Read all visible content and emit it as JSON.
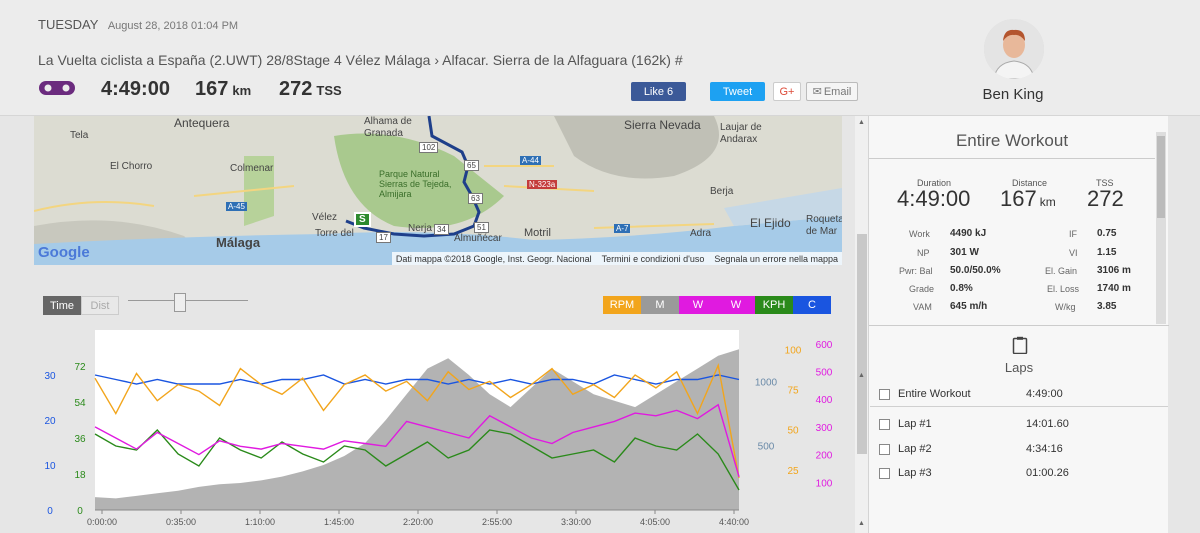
{
  "header": {
    "day": "TUESDAY",
    "date_sub": "August 28, 2018 01:04 PM",
    "title": "La Vuelta ciclista a España (2.UWT) 28/8Stage 4   Vélez Málaga › Alfacar. Sierra de la Alfaguara (162k) #",
    "duration": "4:49:00",
    "distance": "167",
    "distance_unit": "km",
    "tss": "272",
    "tss_unit": "TSS",
    "like_label": "Like 6",
    "tweet_label": "Tweet",
    "gplus_label": "G+",
    "email_label": "Email"
  },
  "user": {
    "name": "Ben King"
  },
  "map": {
    "labels": [
      "Antequera",
      "Alhama de Granada",
      "Tela",
      "Colmenar",
      "El Chorro",
      "Parque Natural Sierras de Tejeda, Almijara",
      "Vélez",
      "Torre del Mar",
      "Málaga",
      "Nerja",
      "Almuñécar",
      "Motril",
      "Sierra Nevada",
      "Laujar de Andarax",
      "Berja",
      "El Ejido",
      "Adra",
      "Roquetas de Mar"
    ],
    "roads": [
      "A-45",
      "A-44",
      "N-323a",
      "A-7"
    ],
    "route_marks": [
      "102",
      "65",
      "63",
      "51",
      "34",
      "17"
    ],
    "start_marker": "S",
    "google": "Google",
    "credits": [
      "Dati mappa ©2018 Google, Inst. Geogr. Nacional",
      "Termini e condizioni d'uso",
      "Segnala un errore nella mappa"
    ]
  },
  "chart_controls": {
    "time_label": "Time",
    "dist_label": "Dist",
    "legend": [
      {
        "label": "RPM",
        "color": "#f2a51c"
      },
      {
        "label": "M",
        "color": "#9a9a9a"
      },
      {
        "label": "W",
        "color": "#e01ae0"
      },
      {
        "label": "W",
        "color": "#e01ae0"
      },
      {
        "label": "KPH",
        "color": "#2a8a1a"
      },
      {
        "label": "C",
        "color": "#1a55e0"
      }
    ]
  },
  "chart_data": {
    "type": "line",
    "x": [
      "0:00:00",
      "0:35:00",
      "1:10:00",
      "1:45:00",
      "2:20:00",
      "2:55:00",
      "3:30:00",
      "4:05:00",
      "4:40:00"
    ],
    "axes": {
      "blue_left": [
        "0",
        "10",
        "20",
        "30"
      ],
      "green_left": [
        "0",
        "18",
        "36",
        "54",
        "72"
      ],
      "elev_right": [
        "500",
        "1000"
      ],
      "orange_right": [
        "25",
        "50",
        "75",
        "100"
      ],
      "magenta_right": [
        "100",
        "200",
        "300",
        "400",
        "500",
        "600"
      ]
    },
    "series": [
      {
        "color": "#1a55e0",
        "values": [
          30,
          29,
          28,
          29,
          28,
          28,
          28,
          29,
          28,
          29,
          29,
          30,
          28,
          29,
          28,
          29,
          29,
          28,
          29,
          28,
          29,
          28,
          29,
          29,
          28,
          30,
          29,
          28,
          29,
          29,
          30,
          29
        ]
      },
      {
        "color": "#f2a51c",
        "values": [
          82,
          60,
          85,
          68,
          78,
          74,
          65,
          88,
          78,
          72,
          82,
          62,
          78,
          84,
          74,
          80,
          68,
          86,
          75,
          80,
          70,
          78,
          88,
          72,
          78,
          70,
          84,
          76,
          86,
          60,
          90,
          20
        ]
      },
      {
        "color": "#2a8a1a",
        "values": [
          38,
          32,
          30,
          40,
          28,
          22,
          36,
          30,
          26,
          34,
          28,
          24,
          32,
          30,
          22,
          28,
          34,
          26,
          30,
          40,
          38,
          32,
          26,
          28,
          30,
          24,
          36,
          32,
          30,
          38,
          28,
          10
        ]
      },
      {
        "color": "#e01ae0",
        "values": [
          300,
          260,
          220,
          280,
          240,
          200,
          250,
          230,
          220,
          240,
          230,
          220,
          250,
          240,
          230,
          320,
          300,
          280,
          260,
          340,
          300,
          260,
          240,
          280,
          300,
          320,
          350,
          340,
          360,
          330,
          380,
          120
        ]
      },
      {
        "color": "#9a9a9a",
        "values": [
          100,
          90,
          110,
          130,
          150,
          180,
          200,
          210,
          230,
          260,
          300,
          350,
          420,
          520,
          700,
          900,
          1100,
          1180,
          1050,
          900,
          800,
          950,
          1100,
          1000,
          900,
          850,
          800,
          900,
          1000,
          1100,
          1200,
          1250
        ]
      }
    ]
  },
  "workout": {
    "title": "Entire Workout",
    "summary": [
      {
        "label": "Duration",
        "value": "4:49:00",
        "unit": ""
      },
      {
        "label": "Distance",
        "value": "167",
        "unit": "km"
      },
      {
        "label": "TSS",
        "value": "272",
        "unit": ""
      }
    ],
    "rows": [
      {
        "l": "Work",
        "lv": "4490 kJ",
        "r": "IF",
        "rv": "0.75"
      },
      {
        "l": "NP",
        "lv": "301 W",
        "r": "VI",
        "rv": "1.15"
      },
      {
        "l": "Pwr: Bal",
        "lv": "50.0/50.0%",
        "r": "El. Gain",
        "rv": "3106 m"
      },
      {
        "l": "Grade",
        "lv": "0.8%",
        "r": "El. Loss",
        "rv": "1740 m"
      },
      {
        "l": "VAM",
        "lv": "645 m/h",
        "r": "W/kg",
        "rv": "3.85"
      }
    ]
  },
  "laps": {
    "title": "Laps",
    "items": [
      {
        "name": "Entire Workout",
        "time": "4:49:00"
      },
      {
        "name": "Lap #1",
        "time": "14:01.60"
      },
      {
        "name": "Lap #2",
        "time": "4:34:16"
      },
      {
        "name": "Lap #3",
        "time": "01:00.26"
      }
    ]
  }
}
